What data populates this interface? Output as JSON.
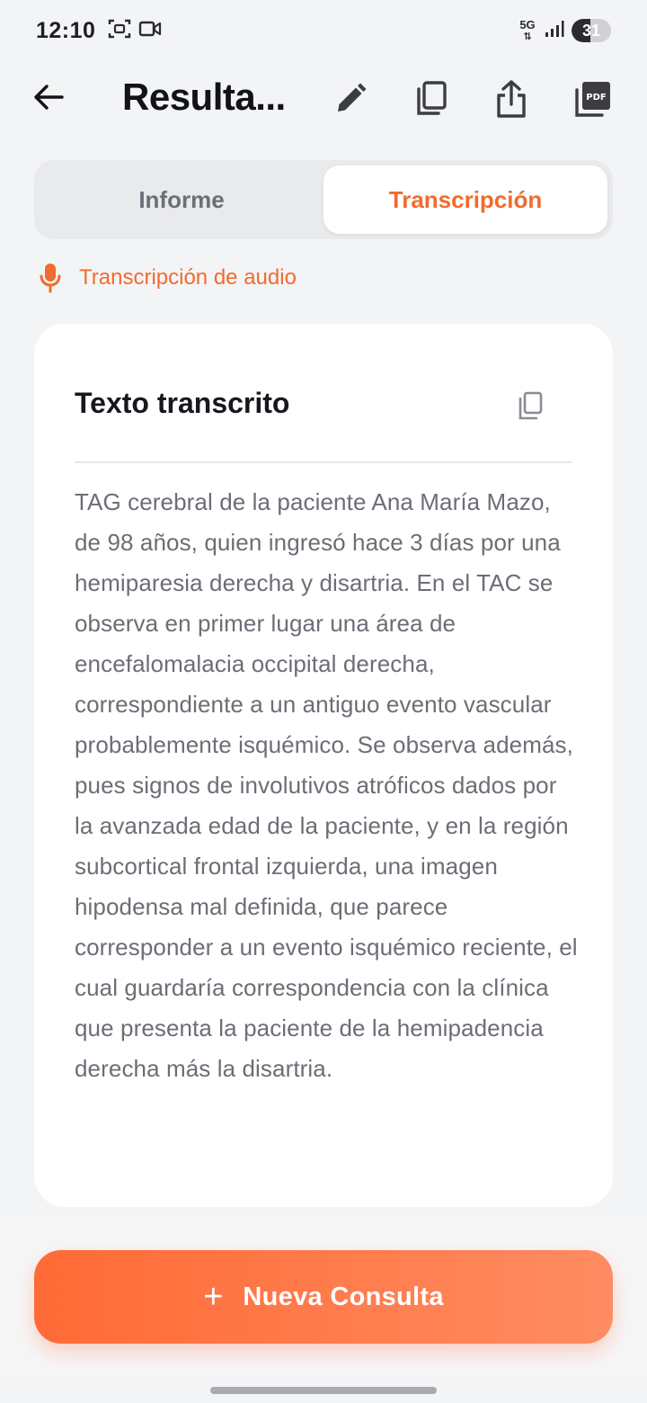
{
  "status_bar": {
    "time": "12:10",
    "network": "5G",
    "battery": "31",
    "icons": [
      "screenshot-icon",
      "video-record-icon",
      "signal-icon",
      "battery-icon"
    ]
  },
  "app_bar": {
    "title": "Resulta...",
    "icons": [
      "back-arrow-icon",
      "edit-icon",
      "copy-icon",
      "share-icon",
      "pdf-icon"
    ]
  },
  "tabs": [
    {
      "label": "Informe",
      "active": false
    },
    {
      "label": "Transcripción",
      "active": true
    }
  ],
  "section": {
    "icon": "microphone-icon",
    "label": "Transcripción de audio"
  },
  "card": {
    "title": "Texto transcrito",
    "copy_icon": "copy-icon",
    "body": "TAG cerebral de la paciente Ana María Mazo, de 98 años, quien ingresó hace 3 días por una hemiparesia derecha y disartria. En el TAC se observa en primer lugar una área de encefalomalacia occipital derecha, correspondiente a un antiguo evento vascular probablemente isquémico. Se observa además, pues signos de involutivos atróficos dados por la avanzada edad de la paciente, y en la región subcortical frontal izquierda, una imagen hipodensa mal definida, que parece corresponder a un evento isquémico reciente, el cual guardaría correspondencia con la clínica que presenta la paciente de la hemipadencia derecha más la disartria."
  },
  "action": {
    "plus": "+",
    "label": "Nueva Consulta"
  },
  "colors": {
    "accent": "#f26b2e",
    "button_gradient_start": "#ff6a35",
    "button_gradient_end": "#ff8c62",
    "background": "#f3f4f6",
    "card": "#ffffff",
    "body_text": "#6b6e76"
  }
}
